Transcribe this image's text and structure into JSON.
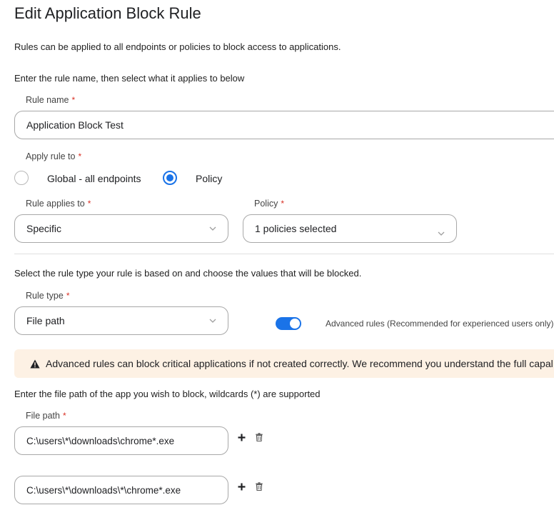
{
  "page": {
    "title": "Edit Application Block Rule",
    "intro": "Rules can be applied to all endpoints or policies to block access to applications.",
    "name_instruction": "Enter the rule name, then select what it applies to below"
  },
  "rule_name": {
    "label": "Rule name",
    "required": "*",
    "value": "Application Block Test"
  },
  "apply_rule_to": {
    "label": "Apply rule to",
    "required": "*",
    "options": [
      "Global - all endpoints",
      "Policy"
    ],
    "selected": "Policy"
  },
  "rule_applies_to": {
    "label": "Rule applies to",
    "required": "*",
    "value": "Specific"
  },
  "policy": {
    "label": "Policy",
    "required": "*",
    "value": "1 policies selected"
  },
  "type_instruction": "Select the rule type your rule is based on and choose the values that will be blocked.",
  "rule_type": {
    "label": "Rule type",
    "required": "*",
    "value": "File path"
  },
  "advanced": {
    "label": "Advanced rules (Recommended for experienced users only)",
    "enabled": true
  },
  "warning": {
    "text": "Advanced rules can block critical applications if not created correctly. We recommend you understand the full capal"
  },
  "file_path_instruction": "Enter the file path of the app you wish to block, wildcards (*) are supported",
  "file_path": {
    "label": "File path",
    "required": "*",
    "entries": [
      "C:\\users\\*\\downloads\\chrome*.exe",
      "C:\\users\\*\\downloads\\*\\chrome*.exe"
    ]
  },
  "icons": {
    "add": "plus-icon",
    "delete": "trash-icon",
    "warning": "warning-triangle-icon",
    "dropdown": "chevron-down-icon"
  },
  "colors": {
    "accent": "#1a73e8",
    "required": "#d93025",
    "warning_bg": "#fdf1e4"
  }
}
